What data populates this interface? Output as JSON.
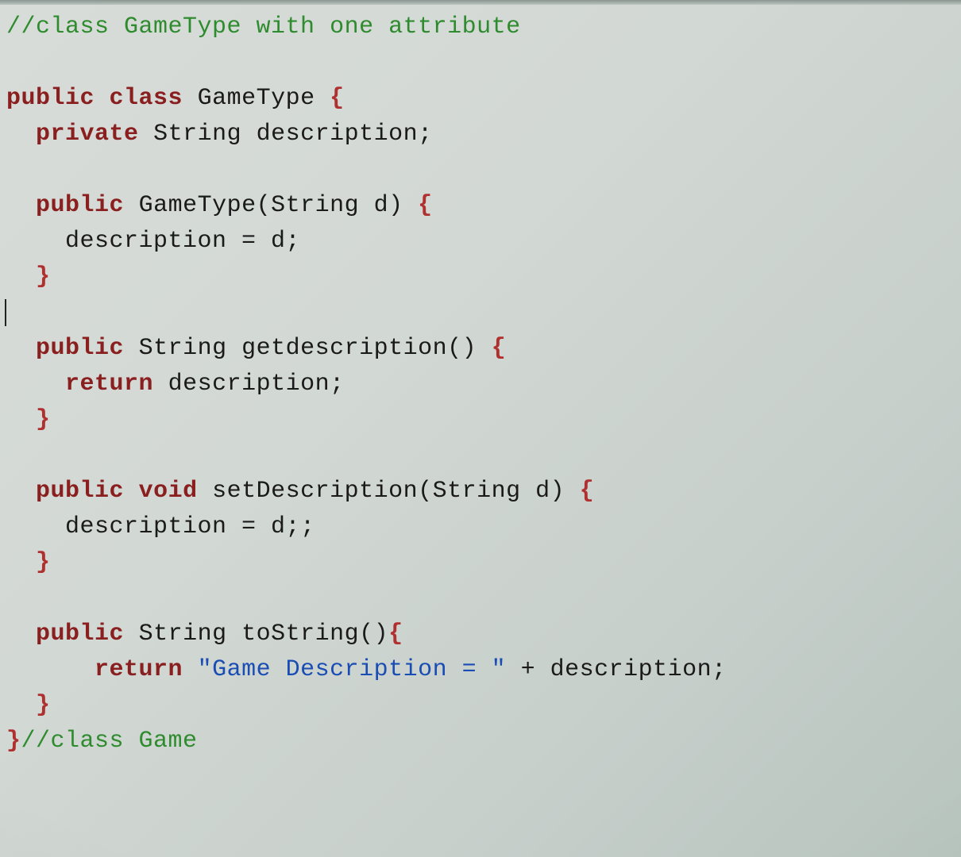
{
  "code": {
    "comment_top": "//class GameType with one attribute",
    "kw_public1": "public",
    "kw_class": "class",
    "name_GameType": "GameType",
    "brace_open": "{",
    "kw_private": "private",
    "type_String": "String",
    "field_description": "description",
    "semi": ";",
    "kw_public2": "public",
    "ctor_name": "GameType",
    "ctor_params": "(String d)",
    "brace_open2": "{",
    "stmt_assign1": "description = d;",
    "brace_close": "}",
    "kw_public3": "public",
    "ret_String1": "String",
    "getter_name": "getdescription",
    "parens_empty": "()",
    "brace_open3": "{",
    "kw_return1": "return",
    "ret_expr1": "description;",
    "brace_close2": "}",
    "kw_public4": "public",
    "kw_void": "void",
    "setter_name": "setDescription",
    "setter_params": "(String d)",
    "brace_open4": "{",
    "stmt_assign2": "description = d;;",
    "brace_close3": "}",
    "kw_public5": "public",
    "ret_String2": "String",
    "tostring_name": "toString",
    "parens_empty2": "()",
    "brace_open5": "{",
    "kw_return2": "return",
    "str_literal": "\"Game Description = \"",
    "plus_desc": " + description;",
    "brace_close4": "}",
    "brace_close_class": "}",
    "comment_end": "//class Game"
  }
}
